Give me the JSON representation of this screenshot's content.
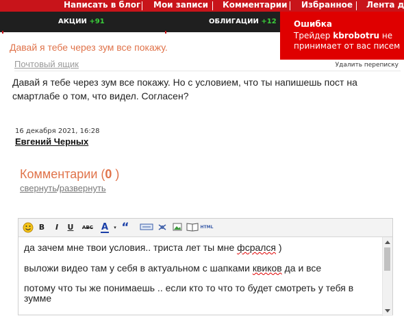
{
  "top_nav": [
    {
      "label": "Написать в блог"
    },
    {
      "label": "Мои записи"
    },
    {
      "label": "Комментарии"
    },
    {
      "label": "Избранное"
    },
    {
      "label": "Лента др"
    }
  ],
  "sub_nav": [
    {
      "label": "АКЦИИ",
      "change": "+91"
    },
    {
      "label": "ОБЛИГАЦИИ",
      "change": "+12"
    }
  ],
  "error_popup": {
    "title": "Ошибка",
    "msg_prefix": "Трейдер",
    "msg_user": "kbrobotru",
    "msg_suffix": "не принимает от вас писем"
  },
  "message": {
    "subject": "Давай я тебе через зум все покажу.",
    "mailbox_link": "Почтовый ящик",
    "delete_link": "Удалить переписку",
    "body": "Давай я тебе через зум все покажу. Но с условием, что ты напишешь пост на смартлабе о том, что видел. Согласен?",
    "date": "16 декабря 2021, 16:28",
    "author": "Евгений Черных"
  },
  "comments": {
    "title": "Комментарии (",
    "count": "0",
    "title_end": " )",
    "collapse": "свернуть",
    "separator": "/",
    "expand": "развернуть"
  },
  "editor": {
    "toolbar": {
      "bold": "B",
      "italic": "I",
      "underline": "U",
      "strike": "ABC",
      "color": "A",
      "quote": "“",
      "html": "HTML"
    },
    "lines": [
      {
        "before": "да зачем мне твои условия.. триста лет ты мне ",
        "misspelled": "фсрался",
        "after": " )"
      },
      {
        "before": "выложи видео там у себя в актуальном с шапками ",
        "misspelled": "квиков",
        "after": " да и все"
      },
      {
        "before": "потому что ты же понимаешь .. если кто то что то будет смотреть у тебя в",
        "misspelled": "",
        "after": ""
      },
      {
        "before": "зумме",
        "misspelled": "",
        "after": ""
      }
    ]
  },
  "colors": {
    "brand_red": "#c8141a",
    "error_red": "#df0000",
    "accent_orange": "#e0734a",
    "positive_green": "#3ad13a"
  }
}
